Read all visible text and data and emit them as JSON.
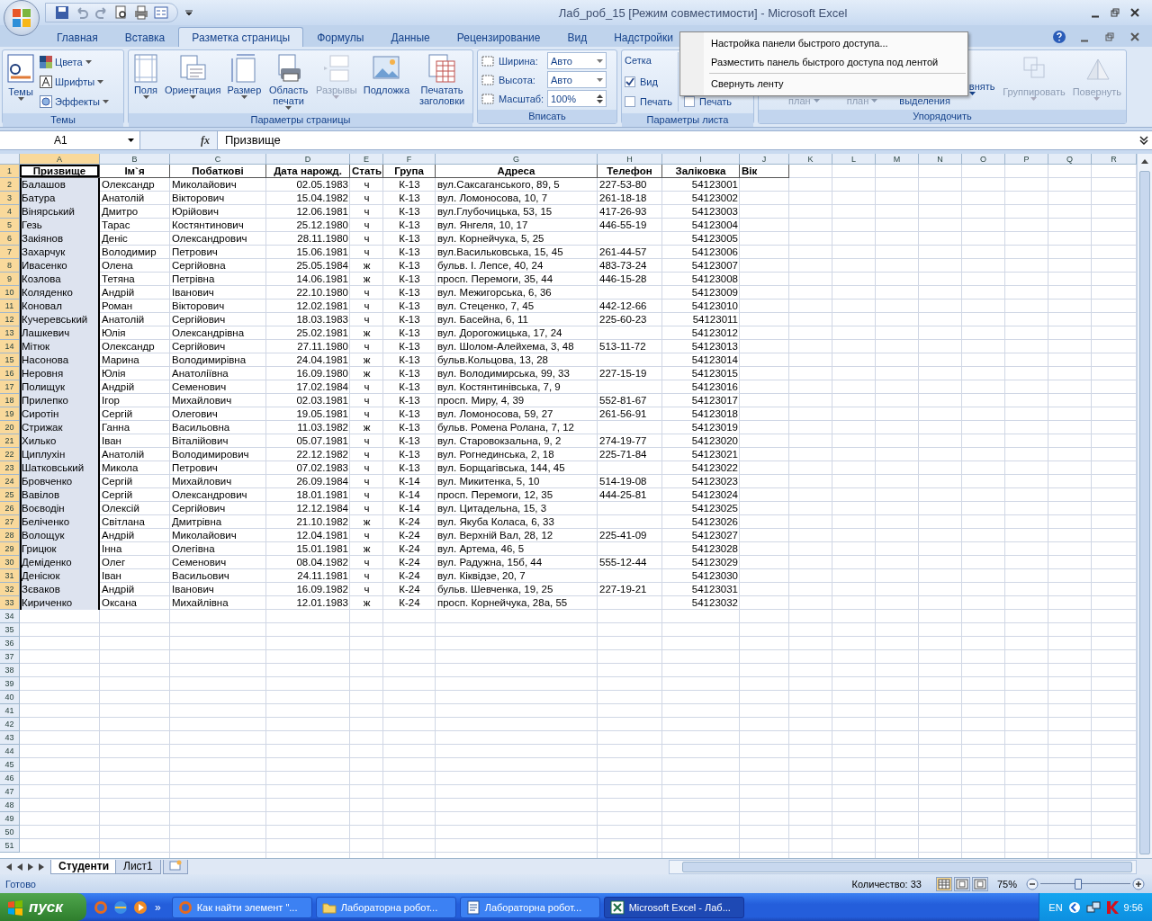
{
  "window": {
    "title": "Лаб_роб_15  [Режим совместимости] - Microsoft Excel"
  },
  "tabs": [
    {
      "label": "Главная",
      "selected": false
    },
    {
      "label": "Вставка",
      "selected": false
    },
    {
      "label": "Разметка страницы",
      "selected": true
    },
    {
      "label": "Формулы",
      "selected": false
    },
    {
      "label": "Данные",
      "selected": false
    },
    {
      "label": "Рецензирование",
      "selected": false
    },
    {
      "label": "Вид",
      "selected": false
    },
    {
      "label": "Надстройки",
      "selected": false
    }
  ],
  "ribbon": {
    "themes": {
      "title": "Темы",
      "big": {
        "label": "Темы",
        "dropdown": true
      },
      "small": [
        {
          "label": "Цвета"
        },
        {
          "label": "Шрифты"
        },
        {
          "label": "Эффекты"
        }
      ]
    },
    "page_setup": {
      "title": "Параметры страницы",
      "buttons": [
        {
          "label": "Поля",
          "dropdown": true,
          "disabled": false
        },
        {
          "label": "Ориентация",
          "dropdown": true,
          "disabled": false
        },
        {
          "label": "Размер",
          "dropdown": true,
          "disabled": false
        },
        {
          "label": "Область печати",
          "dropdown": true,
          "disabled": false
        },
        {
          "label": "Разрывы",
          "dropdown": true,
          "disabled": true
        },
        {
          "label": "Подложка",
          "dropdown": false,
          "disabled": false
        },
        {
          "label": "Печатать заголовки",
          "dropdown": false,
          "disabled": false
        }
      ]
    },
    "scale": {
      "title": "Вписать",
      "rows": [
        {
          "label": "Ширина:",
          "value": "Авто"
        },
        {
          "label": "Высота:",
          "value": "Авто"
        },
        {
          "label": "Масштаб:",
          "value": "100%"
        }
      ]
    },
    "sheet_options": {
      "title": "Параметры листа",
      "heading": "Сетка",
      "options": [
        {
          "label": "Вид",
          "checked": true
        },
        {
          "label": "Печать",
          "checked": false
        }
      ],
      "second_column": [
        {
          "label": "Печать",
          "checked": false
        }
      ]
    },
    "arrange": {
      "title": "Упорядочить",
      "items": [
        {
          "label": "план",
          "kind": "covered",
          "disabled": true
        },
        {
          "label": "план",
          "kind": "covered",
          "disabled": true
        },
        {
          "label": "выделения",
          "kind": "covered",
          "disabled": false
        },
        {
          "label": "внять",
          "kind": "partial",
          "disabled": false
        },
        {
          "label": "Группировать",
          "kind": "button",
          "disabled": true
        },
        {
          "label": "Повернуть",
          "kind": "button",
          "disabled": true
        }
      ]
    }
  },
  "context_menu": {
    "items": [
      {
        "label": "Настройка панели быстрого доступа...",
        "separator_after": false
      },
      {
        "label": "Разместить панель быстрого доступа под лентой",
        "separator_after": true
      },
      {
        "label": "Свернуть ленту",
        "separator_after": false
      }
    ]
  },
  "formula_bar": {
    "name_box": "A1",
    "function_symbol": "fx",
    "value": "Призвище"
  },
  "grid": {
    "columns": [
      {
        "label": "A",
        "selected": true
      },
      {
        "label": "B",
        "selected": false
      },
      {
        "label": "C",
        "selected": false
      },
      {
        "label": "D",
        "selected": false
      },
      {
        "label": "E",
        "selected": false
      },
      {
        "label": "F",
        "selected": false
      },
      {
        "label": "G",
        "selected": false
      },
      {
        "label": "H",
        "selected": false
      },
      {
        "label": "I",
        "selected": false
      },
      {
        "label": "J",
        "selected": false
      },
      {
        "label": "K",
        "selected": false
      },
      {
        "label": "L",
        "selected": false
      },
      {
        "label": "M",
        "selected": false
      },
      {
        "label": "N",
        "selected": false
      },
      {
        "label": "O",
        "selected": false
      },
      {
        "label": "P",
        "selected": false
      },
      {
        "label": "Q",
        "selected": false
      },
      {
        "label": "R",
        "selected": false
      }
    ],
    "rows": [
      {
        "number": "1",
        "selected": true,
        "kind": "header",
        "cells": [
          "Призвище",
          "Ім`я",
          "Побаткові",
          "Дата нарожд.",
          "Стать",
          "Група",
          "Адреса",
          "Телефон",
          "Заліковка",
          "Вік"
        ]
      },
      {
        "number": "2",
        "selected": true,
        "kind": "data",
        "cells": [
          "Балашов",
          "Олександр",
          "Миколайович",
          "02.05.1983",
          "ч",
          "К-13",
          "вул.Саксаганського, 89, 5",
          "227-53-80",
          "54123001"
        ]
      },
      {
        "number": "3",
        "selected": true,
        "kind": "data",
        "cells": [
          "Батура",
          "Анатолій",
          "Вікторович",
          "15.04.1982",
          "ч",
          "К-13",
          "вул. Ломоносова, 10, 7",
          "261-18-18",
          "54123002"
        ]
      },
      {
        "number": "4",
        "selected": true,
        "kind": "data",
        "cells": [
          "Вінярський",
          "Дмитро",
          "Юрійович",
          "12.06.1981",
          "ч",
          "К-13",
          "вул.Глубочицька, 53, 15",
          "417-26-93",
          "54123003"
        ]
      },
      {
        "number": "5",
        "selected": true,
        "kind": "data",
        "cells": [
          "Гезь",
          "Тарас",
          "Костянтинович",
          "25.12.1980",
          "ч",
          "К-13",
          "вул. Янгеля, 10, 17",
          "446-55-19",
          "54123004"
        ]
      },
      {
        "number": "6",
        "selected": true,
        "kind": "data",
        "cells": [
          "Закіянов",
          "Деніс",
          "Олександрович",
          "28.11.1980",
          "ч",
          "К-13",
          "вул. Корнейчука, 5, 25",
          null,
          "54123005"
        ]
      },
      {
        "number": "7",
        "selected": true,
        "kind": "data",
        "cells": [
          "Захарчук",
          "Володимир",
          "Петрович",
          "15.06.1981",
          "ч",
          "К-13",
          "вул.Васильковська, 15, 45",
          "261-44-57",
          "54123006"
        ]
      },
      {
        "number": "8",
        "selected": true,
        "kind": "data",
        "cells": [
          "Ивасенко",
          "Олена",
          "Сергійовна",
          "25.05.1984",
          "ж",
          "К-13",
          "бульв. І. Лепсе, 40, 24",
          "483-73-24",
          "54123007"
        ]
      },
      {
        "number": "9",
        "selected": true,
        "kind": "data",
        "cells": [
          "Козлова",
          "Тетяна",
          "Петрівна",
          "14.06.1981",
          "ж",
          "К-13",
          "просп. Перемоги, 35, 44",
          "446-15-28",
          "54123008"
        ]
      },
      {
        "number": "10",
        "selected": true,
        "kind": "data",
        "cells": [
          "Коляденко",
          "Андрій",
          "Іванович",
          "22.10.1980",
          "ч",
          "К-13",
          "вул. Межигорська, 6, 36",
          null,
          "54123009"
        ]
      },
      {
        "number": "11",
        "selected": true,
        "kind": "data",
        "cells": [
          "Коновал",
          "Роман",
          "Вікторович",
          "12.02.1981",
          "ч",
          "К-13",
          "вул. Стеценко, 7, 45",
          "442-12-66",
          "54123010"
        ]
      },
      {
        "number": "12",
        "selected": true,
        "kind": "data",
        "cells": [
          "Кучеревський",
          "Анатолій",
          "Сергійович",
          "18.03.1983",
          "ч",
          "К-13",
          "вул. Басейна, 6, 11",
          "225-60-23",
          "54123011"
        ]
      },
      {
        "number": "13",
        "selected": true,
        "kind": "data",
        "cells": [
          "Лашкевич",
          "Юлія",
          "Олександрівна",
          "25.02.1981",
          "ж",
          "К-13",
          "вул. Дорогожицька, 17, 24",
          null,
          "54123012"
        ]
      },
      {
        "number": "14",
        "selected": true,
        "kind": "data",
        "cells": [
          "Мітюк",
          "Олександр",
          "Сергійович",
          "27.11.1980",
          "ч",
          "К-13",
          "вул. Шолом-Алейхема, 3, 48",
          "513-11-72",
          "54123013"
        ]
      },
      {
        "number": "15",
        "selected": true,
        "kind": "data",
        "cells": [
          "Насонова",
          "Марина",
          "Володимирівна",
          "24.04.1981",
          "ж",
          "К-13",
          "бульв.Кольцова, 13, 28",
          null,
          "54123014"
        ]
      },
      {
        "number": "16",
        "selected": true,
        "kind": "data",
        "cells": [
          "Неровня",
          "Юлія",
          "Анатоліївна",
          "16.09.1980",
          "ж",
          "К-13",
          "вул. Володимирська, 99, 33",
          "227-15-19",
          "54123015"
        ]
      },
      {
        "number": "17",
        "selected": true,
        "kind": "data",
        "cells": [
          "Полищук",
          "Андрій",
          "Семенович",
          "17.02.1984",
          "ч",
          "К-13",
          "вул. Костянтинівська, 7, 9",
          null,
          "54123016"
        ]
      },
      {
        "number": "18",
        "selected": true,
        "kind": "data",
        "cells": [
          "Прилепко",
          "Ігор",
          "Михайлович",
          "02.03.1981",
          "ч",
          "К-13",
          "просп. Миру, 4, 39",
          "552-81-67",
          "54123017"
        ]
      },
      {
        "number": "19",
        "selected": true,
        "kind": "data",
        "cells": [
          "Сиротін",
          "Сергій",
          "Олегович",
          "19.05.1981",
          "ч",
          "К-13",
          "вул. Ломоносова, 59, 27",
          "261-56-91",
          "54123018"
        ]
      },
      {
        "number": "20",
        "selected": true,
        "kind": "data",
        "cells": [
          "Стрижак",
          "Ганна",
          "Васильовна",
          "11.03.1982",
          "ж",
          "К-13",
          "бульв. Ромена Ролана, 7, 12",
          null,
          "54123019"
        ]
      },
      {
        "number": "21",
        "selected": true,
        "kind": "data",
        "cells": [
          "Хилько",
          "Іван",
          "Віталійович",
          "05.07.1981",
          "ч",
          "К-13",
          "вул. Старовокзальна, 9, 2",
          "274-19-77",
          "54123020"
        ]
      },
      {
        "number": "22",
        "selected": true,
        "kind": "data",
        "cells": [
          "Циплухін",
          "Анатолій",
          "Володимирович",
          "22.12.1982",
          "ч",
          "К-13",
          "вул. Рогнединська, 2, 18",
          "225-71-84",
          "54123021"
        ]
      },
      {
        "number": "23",
        "selected": true,
        "kind": "data",
        "cells": [
          "Шатковський",
          "Микола",
          "Петрович",
          "07.02.1983",
          "ч",
          "К-13",
          "вул. Борщагівська, 144, 45",
          null,
          "54123022"
        ]
      },
      {
        "number": "24",
        "selected": true,
        "kind": "data",
        "cells": [
          "Бровченко",
          "Сергій",
          "Михайлович",
          "26.09.1984",
          "ч",
          "К-14",
          "вул. Микитенка, 5, 10",
          "514-19-08",
          "54123023"
        ]
      },
      {
        "number": "25",
        "selected": true,
        "kind": "data",
        "cells": [
          "Вавілов",
          "Сергій",
          "Олександрович",
          "18.01.1981",
          "ч",
          "К-14",
          "просп. Перемоги, 12, 35",
          "444-25-81",
          "54123024"
        ]
      },
      {
        "number": "26",
        "selected": true,
        "kind": "data",
        "cells": [
          "Воєводін",
          "Олексій",
          "Сергійович",
          "12.12.1984",
          "ч",
          "К-14",
          "вул. Цитадельна, 15, 3",
          null,
          "54123025"
        ]
      },
      {
        "number": "27",
        "selected": true,
        "kind": "data",
        "cells": [
          "Беліченко",
          "Світлана",
          "Дмитрівна",
          "21.10.1982",
          "ж",
          "К-24",
          "вул. Якуба Коласа, 6, 33",
          null,
          "54123026"
        ]
      },
      {
        "number": "28",
        "selected": true,
        "kind": "data",
        "cells": [
          "Волощук",
          "Андрій",
          "Миколайович",
          "12.04.1981",
          "ч",
          "К-24",
          "вул. Верхній Вал, 28, 12",
          "225-41-09",
          "54123027"
        ]
      },
      {
        "number": "29",
        "selected": true,
        "kind": "data",
        "cells": [
          "Грицюк",
          "Інна",
          "Олегівна",
          "15.01.1981",
          "ж",
          "К-24",
          "вул. Артема, 46, 5",
          null,
          "54123028"
        ]
      },
      {
        "number": "30",
        "selected": true,
        "kind": "data",
        "cells": [
          "Деміденко",
          "Олег",
          "Семенович",
          "08.04.1982",
          "ч",
          "К-24",
          "вул. Радужна, 15б, 44",
          "555-12-44",
          "54123029"
        ]
      },
      {
        "number": "31",
        "selected": true,
        "kind": "data",
        "cells": [
          "Денісюк",
          "Іван",
          "Васильович",
          "24.11.1981",
          "ч",
          "К-24",
          "вул. Кіквідзе, 20, 7",
          null,
          "54123030"
        ]
      },
      {
        "number": "32",
        "selected": true,
        "kind": "data",
        "cells": [
          "Зєваков",
          "Андрій",
          "Іванович",
          "16.09.1982",
          "ч",
          "К-24",
          "бульв. Шевченка, 19, 25",
          "227-19-21",
          "54123031"
        ]
      },
      {
        "number": "33",
        "selected": true,
        "kind": "data",
        "cells": [
          "Кириченко",
          "Оксана",
          "Михайлівна",
          "12.01.1983",
          "ж",
          "К-24",
          "просп. Корнейчука, 28а, 55",
          null,
          "54123032"
        ]
      },
      {
        "number": "34",
        "selected": false,
        "kind": "empty"
      },
      {
        "number": "35",
        "selected": false,
        "kind": "empty"
      },
      {
        "number": "36",
        "selected": false,
        "kind": "empty"
      },
      {
        "number": "37",
        "selected": false,
        "kind": "empty"
      },
      {
        "number": "38",
        "selected": false,
        "kind": "empty"
      },
      {
        "number": "39",
        "selected": false,
        "kind": "empty"
      },
      {
        "number": "40",
        "selected": false,
        "kind": "empty"
      },
      {
        "number": "41",
        "selected": false,
        "kind": "empty"
      },
      {
        "number": "42",
        "selected": false,
        "kind": "empty"
      },
      {
        "number": "43",
        "selected": false,
        "kind": "empty"
      },
      {
        "number": "44",
        "selected": false,
        "kind": "empty"
      },
      {
        "number": "45",
        "selected": false,
        "kind": "empty"
      },
      {
        "number": "46",
        "selected": false,
        "kind": "empty"
      },
      {
        "number": "47",
        "selected": false,
        "kind": "empty"
      },
      {
        "number": "48",
        "selected": false,
        "kind": "empty"
      },
      {
        "number": "49",
        "selected": false,
        "kind": "empty"
      },
      {
        "number": "50",
        "selected": false,
        "kind": "empty"
      },
      {
        "number": "51",
        "selected": false,
        "kind": "empty"
      }
    ]
  },
  "sheet_tabs": [
    {
      "label": "Студенти",
      "selected": true
    },
    {
      "label": "Лист1",
      "selected": false
    }
  ],
  "status_bar": {
    "status": "Готово",
    "count": "Количество: 33",
    "zoom": "75%",
    "zoom_level": {
      "level": 0.42
    }
  },
  "taskbar": {
    "start": "пуск",
    "more": "»",
    "tasks": [
      {
        "label": "Как найти элемент \"...",
        "kind": "browser",
        "selected": false
      },
      {
        "label": "Лабораторна робот...",
        "kind": "folder",
        "selected": false
      },
      {
        "label": "Лабораторна робот...",
        "kind": "document",
        "selected": false
      },
      {
        "label": "Microsoft Excel - Лаб...",
        "kind": "spreadsheet",
        "selected": true
      }
    ],
    "language": "EN",
    "clock": "9:56"
  }
}
